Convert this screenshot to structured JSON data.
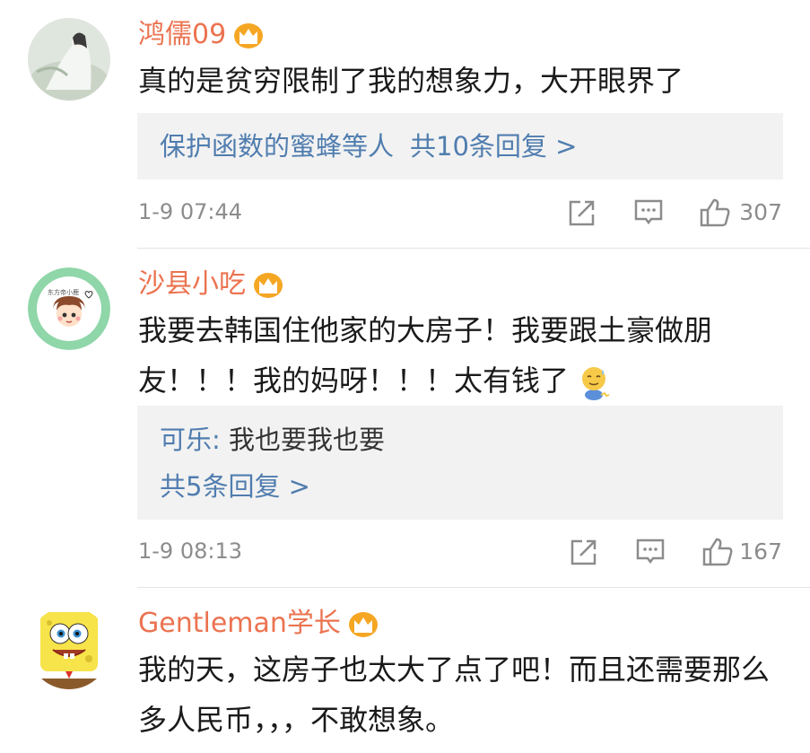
{
  "comments": [
    {
      "username": "鸿儒09",
      "text": "真的是贫穷限制了我的想象力，大开眼界了",
      "reply_summary": {
        "names": "保护函数的蜜蜂等人",
        "count_link": "共10条回复 >"
      },
      "time": "1-9 07:44",
      "likes": "307"
    },
    {
      "username": "沙县小吃",
      "text_line1": "我要去韩国住他家的大房子！我要跟土豪做朋",
      "text_line2": "友！！！我的妈呀！！！太有钱了",
      "reply": {
        "author": "可乐:",
        "content": " 我也要我也要",
        "count_link": "共5条回复 >"
      },
      "time": "1-9 08:13",
      "likes": "167"
    },
    {
      "username": "Gentleman学长",
      "text_line1": "我的天，这房子也太大了点了吧！而且还需要那么",
      "text_line2": "多人民币，，，不敢想象。"
    }
  ],
  "colors": {
    "username": "#eb7350",
    "link": "#507daf",
    "reply_bg": "#f2f2f2",
    "meta": "#8c8c8c",
    "crown": "#f5a623"
  },
  "icons": {
    "badge": "crown-icon",
    "share": "share-icon",
    "comment": "comment-icon",
    "like": "thumbs-up-icon",
    "emoji": "awkward-face-emoji"
  }
}
